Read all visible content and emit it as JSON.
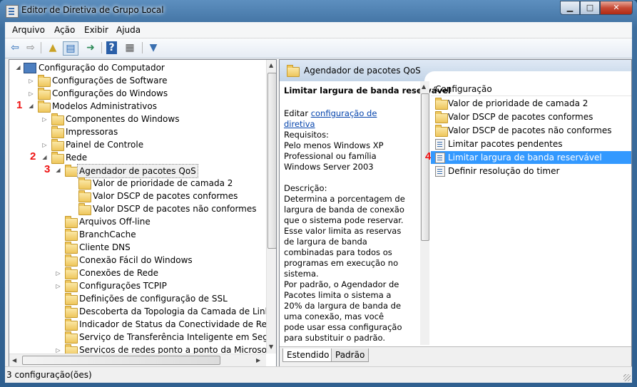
{
  "window": {
    "title": "Editor de Diretiva de Grupo Local"
  },
  "caption_buttons": {
    "minimize": "▁",
    "maximize": "□",
    "close": "✕"
  },
  "menu": [
    "Arquivo",
    "Ação",
    "Exibir",
    "Ajuda"
  ],
  "toolbar": [
    "back-arrow-icon",
    "forward-arrow-icon",
    "up-folder-icon",
    "show-tree-icon",
    "export-icon",
    "help-icon",
    "properties-icon",
    "filter-icon"
  ],
  "tree": {
    "root": "Configuração do Computador",
    "items": [
      {
        "label": "Configurações de Software"
      },
      {
        "label": "Configurações do Windows"
      },
      {
        "label": "Modelos Administrativos",
        "marker": "1"
      },
      {
        "label": "Componentes do Windows"
      },
      {
        "label": "Impressoras"
      },
      {
        "label": "Painel de Controle"
      },
      {
        "label": "Rede",
        "marker": "2"
      },
      {
        "label": "Agendador de pacotes QoS",
        "marker": "3"
      },
      {
        "label": "Valor de prioridade de camada 2"
      },
      {
        "label": "Valor DSCP de pacotes conformes"
      },
      {
        "label": "Valor DSCP de pacotes não conformes"
      },
      {
        "label": "Arquivos Off-line"
      },
      {
        "label": "BranchCache"
      },
      {
        "label": "Cliente DNS"
      },
      {
        "label": "Conexão Fácil do Windows"
      },
      {
        "label": "Conexões de Rede"
      },
      {
        "label": "Configurações TCPIP"
      },
      {
        "label": "Definições de configuração de SSL"
      },
      {
        "label": "Descoberta da Topologia da Camada de Links"
      },
      {
        "label": "Indicador de Status da Conectividade de Rede"
      },
      {
        "label": "Serviço de Transferência Inteligente em Segundo"
      },
      {
        "label": "Serviços de redes ponto a ponto da Microsoft"
      }
    ]
  },
  "right": {
    "header": "Agendador de pacotes QoS",
    "desc_title": "Limitar largura de banda reservável",
    "edit_prefix": "Editar ",
    "edit_link": "configuração de diretiva",
    "requirements": "Requisitos:\nPelo menos Windows XP Professional ou família Windows Server 2003",
    "description": "Descrição:\nDetermina a porcentagem de largura de banda de conexão que o sistema pode reservar. Esse valor limita as reservas de largura de banda combinadas para todos os programas em execução no sistema.",
    "default_text": "Por padrão, o Agendador de Pacotes limita o sistema a 20% da largura de banda de uma conexão, mas você pode usar essa configuração para substituir o padrão.",
    "column_header": "Configuração",
    "settings": [
      {
        "label": "Valor de prioridade de camada 2",
        "kind": "folder"
      },
      {
        "label": "Valor DSCP de pacotes conformes",
        "kind": "folder"
      },
      {
        "label": "Valor DSCP de pacotes não conformes",
        "kind": "folder"
      },
      {
        "label": "Limitar pacotes pendentes",
        "kind": "setting"
      },
      {
        "label": "Limitar largura de banda reservável",
        "kind": "setting",
        "marker": "4"
      },
      {
        "label": "Definir resolução do timer",
        "kind": "setting"
      }
    ],
    "tabs": [
      "Estendido",
      "Padrão"
    ]
  },
  "status": "3 configuração(ões)"
}
